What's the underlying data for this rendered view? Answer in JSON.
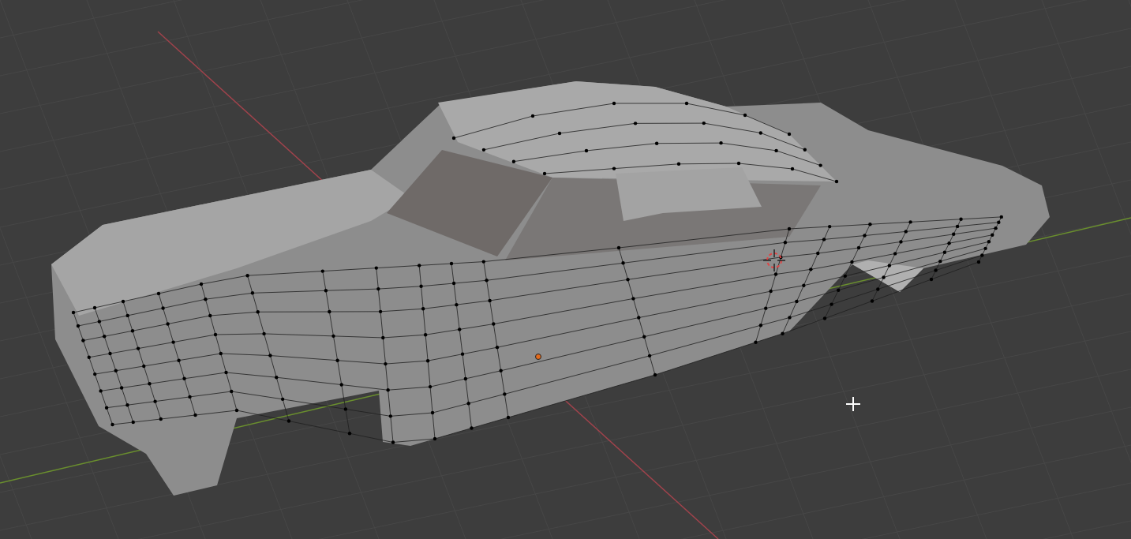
{
  "viewport": {
    "grid": true,
    "x_axis": true,
    "y_axis": true,
    "edit_mode": true
  }
}
